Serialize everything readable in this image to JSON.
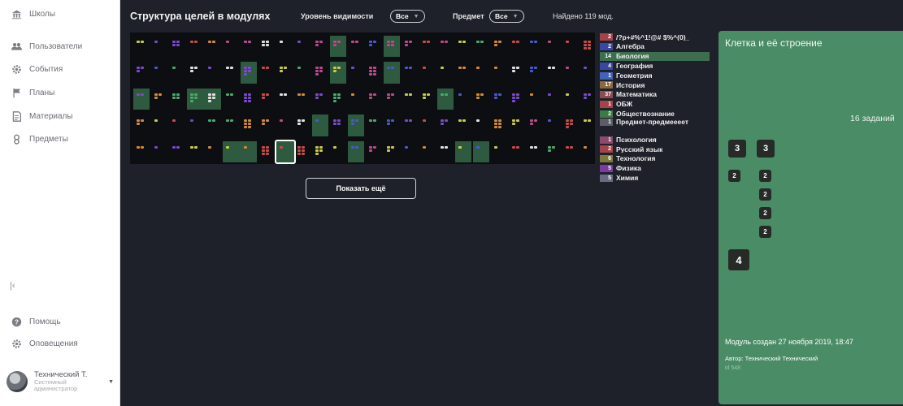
{
  "sidebar": {
    "items": [
      {
        "label": "Школы",
        "icon": "school-icon"
      },
      {
        "label": "Пользователи",
        "icon": "users-icon"
      },
      {
        "label": "События",
        "icon": "gear-icon"
      },
      {
        "label": "Планы",
        "icon": "flag-icon"
      },
      {
        "label": "Материалы",
        "icon": "document-icon"
      },
      {
        "label": "Предметы",
        "icon": "subjects-icon"
      }
    ],
    "bottom_items": [
      {
        "label": "Помощь",
        "icon": "help-icon"
      },
      {
        "label": "Оповещения",
        "icon": "settings-icon"
      }
    ],
    "user": {
      "name": "Технический Т.",
      "role_line1": "Системный",
      "role_line2": "администратор"
    }
  },
  "header": {
    "title": "Структура целей в модулях",
    "visibility_label": "Уровень видимости",
    "visibility_value": "Все",
    "subject_label": "Предмет",
    "subject_value": "Все",
    "found_text": "Найдено 119 мод."
  },
  "show_more_label": "Показать ещё",
  "legend": [
    {
      "count": "2",
      "label": "/?p+#%^1!@# $%^(0)_",
      "color": "#a4434a"
    },
    {
      "count": "2",
      "label": "Алгебра",
      "color": "#3a47a0"
    },
    {
      "count": "14",
      "label": "Биология",
      "color": "#3d6e4f",
      "active": true
    },
    {
      "count": "4",
      "label": "География",
      "color": "#3a47a0"
    },
    {
      "count": "1",
      "label": "Геометрия",
      "color": "#4463b8"
    },
    {
      "count": "17",
      "label": "История",
      "color": "#8a6a3c"
    },
    {
      "count": "37",
      "label": "Математика",
      "color": "#8c4a52"
    },
    {
      "count": "1",
      "label": "ОБЖ",
      "color": "#a4434a"
    },
    {
      "count": "2",
      "label": "Обществознание",
      "color": "#3d7a47"
    },
    {
      "count": "1",
      "label": "Предмет-предмеееет",
      "color": "#5a5d66"
    },
    {
      "count": "1",
      "label": "Психология",
      "color": "#8c4a6c"
    },
    {
      "count": "2",
      "label": "Русский язык",
      "color": "#a4434a"
    },
    {
      "count": "6",
      "label": "Технология",
      "color": "#7a7a3a"
    },
    {
      "count": "5",
      "label": "Физика",
      "color": "#7a3ca0"
    },
    {
      "count": "5",
      "label": "Химия",
      "color": "#6a6a82"
    }
  ],
  "detail": {
    "title": "Клетка и её строение",
    "task_count": "16 заданий",
    "tasks": [
      "3",
      "3",
      "2",
      "2",
      "2",
      "2",
      "2",
      "4"
    ],
    "created": "Модуль создан 27 ноября 2019, 18:47",
    "author": "Автор: Технический Технический",
    "id": "id 548"
  },
  "colors": {
    "background": "#1e2129",
    "accent_green": "#4a8c66",
    "highlight": "#2e5a3f"
  }
}
